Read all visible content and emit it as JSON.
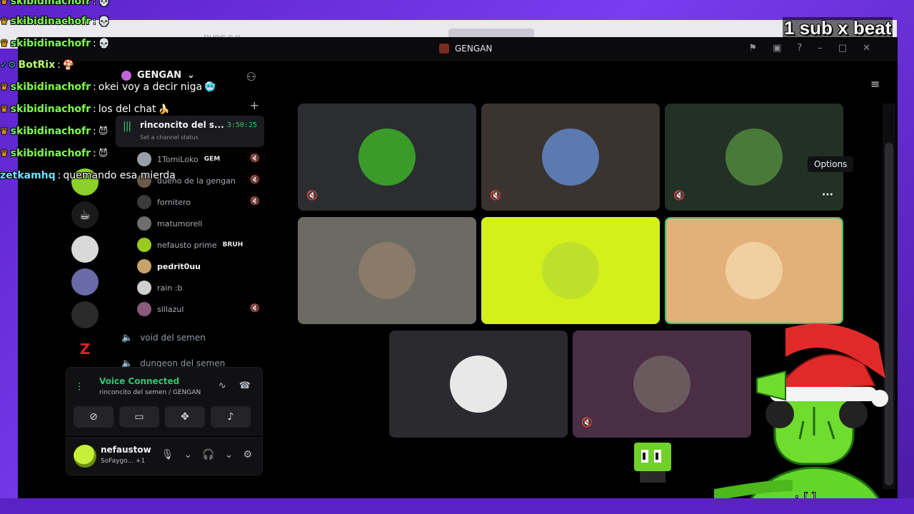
{
  "overlay": {
    "sub_text": "1 sub x beat",
    "chat": [
      {
        "user": "skibidinachofr",
        "message": "",
        "kind": "crown",
        "emoji": "💀"
      },
      {
        "user": "skibidinachofr",
        "message": "",
        "kind": "crown",
        "emoji": "💀"
      },
      {
        "user": "skibidinachofr",
        "message": "",
        "kind": "crown",
        "emoji": "💀"
      },
      {
        "user": "BotRix",
        "message": "",
        "kind": "bot",
        "emoji": "🍄"
      },
      {
        "user": "skibidinachofr",
        "message": "okei voy a decir niga",
        "kind": "crown",
        "emoji": "🥶"
      },
      {
        "user": "skibidinachofr",
        "message": "los del chat",
        "kind": "crown",
        "emoji": "🍌"
      },
      {
        "user": "skibidinachofr",
        "message": "",
        "kind": "crown",
        "emoji": "😈"
      },
      {
        "user": "skibidinachofr",
        "message": "",
        "kind": "crown",
        "emoji": "😈"
      },
      {
        "user": "zetkamhq",
        "message": "quemando esa mierda",
        "kind": "plain",
        "emoji": ""
      }
    ]
  },
  "browser": {
    "tab_text": "RUDE   S  S"
  },
  "window": {
    "title": "GENGAN"
  },
  "sidebar": {
    "server_name": "GENGAN",
    "active_channel": {
      "name": "rinconcito del s...",
      "time": "3:50:25",
      "status": "Set a channel status"
    },
    "members": [
      {
        "name": "1TomiLoko",
        "badge": "GEM",
        "muted": true,
        "color": "#9aa0a6"
      },
      {
        "name": "dueño de la gengan",
        "badge": "",
        "muted": true,
        "color": "#6b5a4a"
      },
      {
        "name": "fornitero",
        "badge": "",
        "muted": true,
        "color": "#3a3a3a"
      },
      {
        "name": "matumorell",
        "badge": "",
        "muted": false,
        "color": "#6e6e6e"
      },
      {
        "name": "nefausto prime",
        "badge": "BRUH",
        "muted": false,
        "color": "#9acb1c"
      },
      {
        "name": "pedrit0uu",
        "badge": "",
        "muted": false,
        "color": "#c9a36a"
      },
      {
        "name": "rain :b",
        "badge": "",
        "muted": false,
        "color": "#cfcfcf"
      },
      {
        "name": "sillazul",
        "badge": "",
        "muted": true,
        "color": "#8a5a7a"
      }
    ],
    "channels": [
      {
        "name": "void del semen"
      },
      {
        "name": "dungeon del semen"
      }
    ]
  },
  "voice_panel": {
    "title": "Voice Connected",
    "subtitle": "rinconcito del semen / GENGAN"
  },
  "user_panel": {
    "name": "nefaustow",
    "status": "SoFaygo... +1"
  },
  "tooltip": {
    "options": "Options"
  },
  "tiles": [
    {
      "bg": "#2b2d31",
      "avatar": "#3a9b2a",
      "muted": true
    },
    {
      "bg": "#3a3330",
      "avatar": "#5a7ab0",
      "muted": true
    },
    {
      "bg": "#233025",
      "avatar": "#4a7a3a",
      "muted": true
    },
    {
      "bg": "#6b6a63",
      "avatar": "#8a7a6a",
      "muted": false
    },
    {
      "bg": "#d4f01b",
      "avatar": "#bfe02a",
      "muted": false
    },
    {
      "bg": "#e3b07a",
      "avatar": "#f0d0a0",
      "muted": false
    },
    {
      "bg": "#2b2a2e",
      "avatar": "#e8e8e8",
      "muted": false
    },
    {
      "bg": "#4a2e44",
      "avatar": "#6a5a5e",
      "muted": true
    }
  ]
}
